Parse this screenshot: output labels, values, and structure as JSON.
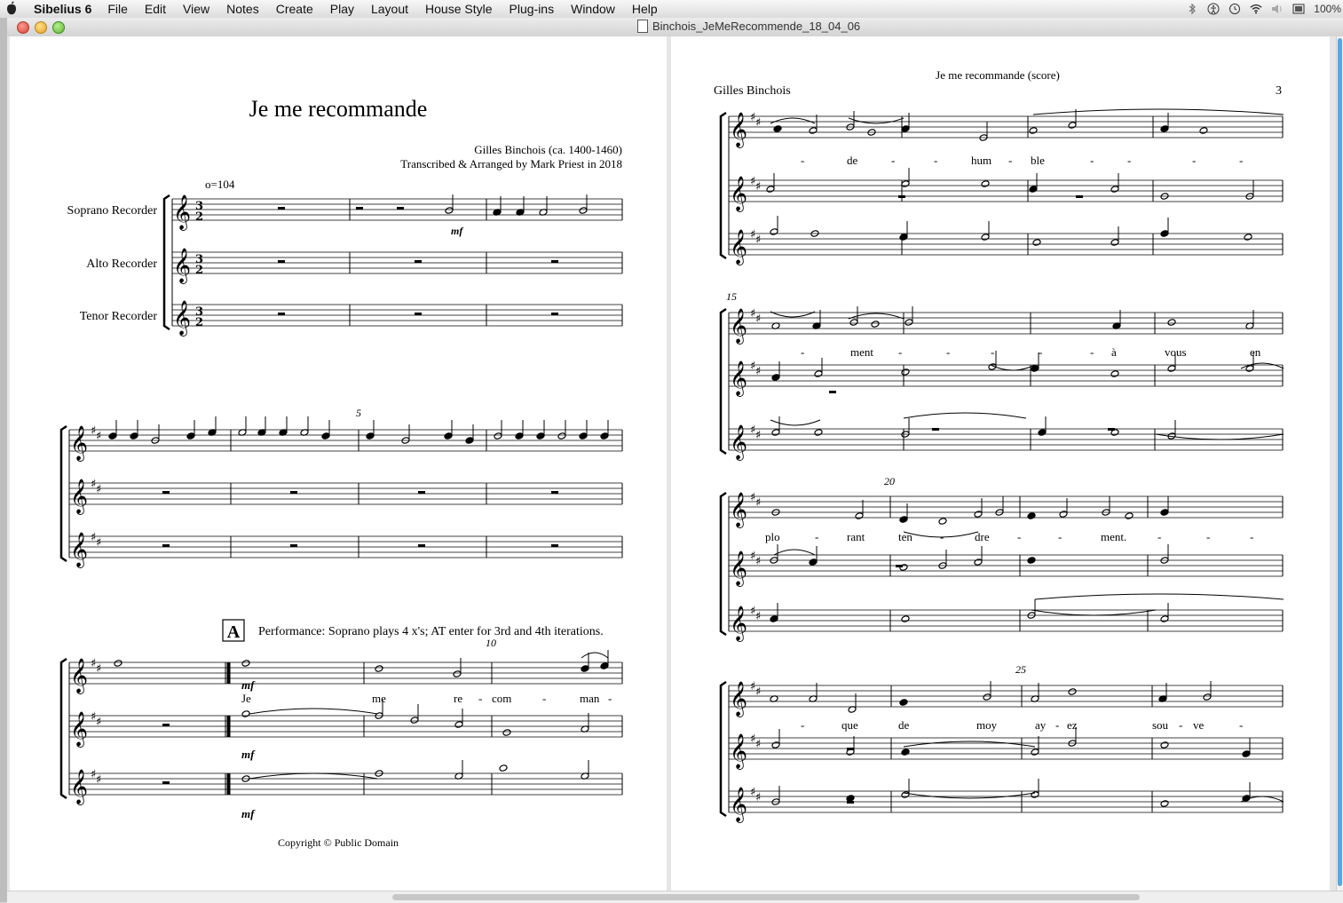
{
  "menubar": {
    "app_name": "Sibelius 6",
    "items": [
      "File",
      "Edit",
      "View",
      "Notes",
      "Create",
      "Play",
      "Layout",
      "House Style",
      "Plug-ins",
      "Window",
      "Help"
    ],
    "battery": "100%",
    "status_icons": [
      "bluetooth-icon",
      "accessibility-icon",
      "time-machine-icon",
      "wifi-icon",
      "volume-icon",
      "input-menu-icon"
    ]
  },
  "window": {
    "title": "Binchois_JeMeRecommende_18_04_06"
  },
  "page1": {
    "title": "Je me recommande",
    "composer": "Gilles Binchois (ca. 1400-1460)",
    "arranger": "Transcribed & Arranged by Mark Priest in 2018",
    "tempo": "o=104",
    "instruments": [
      "Soprano Recorder",
      "Alto Recorder",
      "Tenor Recorder"
    ],
    "bar_number_5": "5",
    "bar_number_10": "10",
    "rehearsal_mark": "A",
    "performance_note": "Performance: Soprano plays 4 x's; AT enter for 3rd and 4th iterations.",
    "dynamic": "mf",
    "lyrics_system3": [
      "Je",
      "me",
      "re",
      "-",
      "com",
      "-",
      "man",
      "-"
    ],
    "copyright": "Copyright © Public Domain"
  },
  "page3": {
    "header": "Je me recommande (score)",
    "composer": "Gilles Binchois",
    "page_number": "3",
    "bar_numbers": [
      "15",
      "20",
      "25"
    ],
    "lyrics_system1": [
      "-",
      "de",
      "-",
      "-",
      "hum",
      "-",
      "ble",
      "-",
      "-",
      "-",
      "-"
    ],
    "lyrics_system2": [
      "-",
      "ment",
      "-",
      "-",
      "-",
      "-",
      "-",
      "à",
      "vous",
      "en"
    ],
    "lyrics_system3": [
      "plo",
      "-",
      "rant",
      "ten",
      "-",
      "dre",
      "-",
      "-",
      "ment.",
      "-",
      "-",
      "-"
    ],
    "lyrics_system4": [
      "-",
      "que",
      "de",
      "moy",
      "ay",
      "-",
      "ez",
      "sou",
      "-",
      "ve",
      "-"
    ]
  }
}
